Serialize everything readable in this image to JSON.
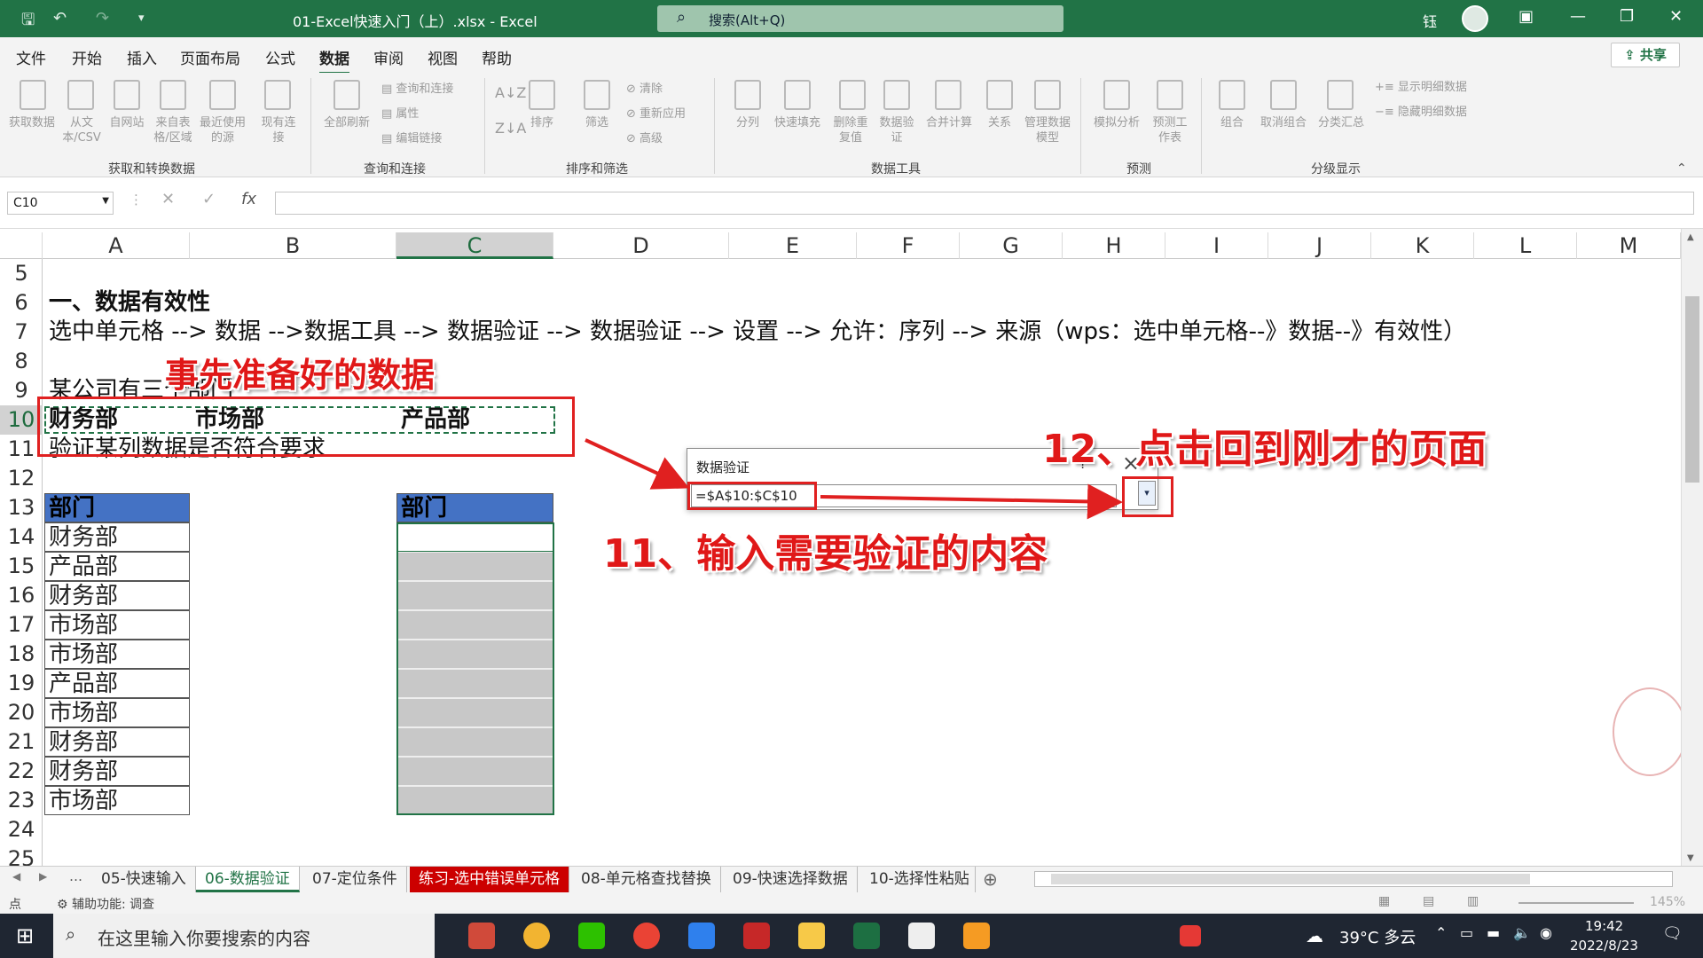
{
  "window": {
    "title": "01-Excel快速入门（上）.xlsx  -  Excel",
    "search_placeholder": "搜索(Alt+Q)",
    "user_initial": "钰"
  },
  "menu": [
    "文件",
    "开始",
    "插入",
    "页面布局",
    "公式",
    "数据",
    "审阅",
    "视图",
    "帮助"
  ],
  "menu_active": "数据",
  "share_label": "共享",
  "ribbon": {
    "get_data": [
      "获取数据",
      "从文本/CSV",
      "自网站",
      "来自表格/区域",
      "最近使用的源",
      "现有连接"
    ],
    "group1": "获取和转换数据",
    "refresh_all": "全部刷新",
    "query_items": [
      "查询和连接",
      "属性",
      "编辑链接"
    ],
    "group2": "查询和连接",
    "sort_filter": [
      "排序",
      "筛选",
      "清除",
      "重新应用",
      "高级"
    ],
    "group3": "排序和筛选",
    "data_tools": [
      "分列",
      "快速填充",
      "删除重复值",
      "数据验证",
      "合并计算",
      "关系",
      "管理数据模型"
    ],
    "group4": "数据工具",
    "forecast": [
      "模拟分析",
      "预测工作表"
    ],
    "group5": "预测",
    "outline": [
      "组合",
      "取消组合",
      "分类汇总",
      "显示明细数据",
      "隐藏明细数据"
    ],
    "group6": "分级显示"
  },
  "name_box": "C10",
  "columns": [
    "A",
    "B",
    "C",
    "D",
    "E",
    "F",
    "G",
    "H",
    "I",
    "J",
    "K",
    "L",
    "M"
  ],
  "rows": [
    "5",
    "6",
    "7",
    "8",
    "9",
    "10",
    "11",
    "12",
    "13",
    "14",
    "15",
    "16",
    "17",
    "18",
    "19",
    "20",
    "21",
    "22",
    "23",
    "24",
    "25"
  ],
  "cells": {
    "r6": "一、数据有效性",
    "r7": "选中单元格 --> 数据 -->数据工具 --> 数据验证 --> 数据验证 --> 设置 --> 允许：序列 --> 来源（wps：选中单元格--》数据--》有效性）",
    "r9": "某公司有三个部门",
    "r10a": "财务部",
    "r10b": "市场部",
    "r10c": "产品部",
    "r11": "验证某列数据是否符合要求",
    "hdr_a": "部门",
    "hdr_c": "部门",
    "dept_list": [
      "财务部",
      "产品部",
      "财务部",
      "市场部",
      "市场部",
      "产品部",
      "市场部",
      "财务部",
      "财务部",
      "市场部"
    ]
  },
  "annotations": {
    "prepared": "事先准备好的数据",
    "step11": "11、输入需要验证的内容",
    "step12": "12、点击回到刚才的页面"
  },
  "dialog": {
    "title": "数据验证",
    "help": "?",
    "close": "×",
    "ref": "=$A$10:$C$10"
  },
  "sheet_tabs": [
    "05-快速输入",
    "06-数据验证",
    "07-定位条件",
    "练习-选中错误单元格",
    "08-单元格查找替换",
    "09-快速选择数据",
    "10-选择性粘贴"
  ],
  "sheet_tab_active": "06-数据验证",
  "status": {
    "mode": "点",
    "accessibility": "辅助功能: 调查",
    "zoom": "145%"
  },
  "taskbar": {
    "search": "在这里输入你要搜索的内容",
    "weather": "39°C  多云",
    "time": "19:42",
    "date": "2022/8/23"
  },
  "colors": {
    "excel_green": "#217346",
    "header_blue": "#4472c4",
    "annotation_red": "#e01818"
  }
}
